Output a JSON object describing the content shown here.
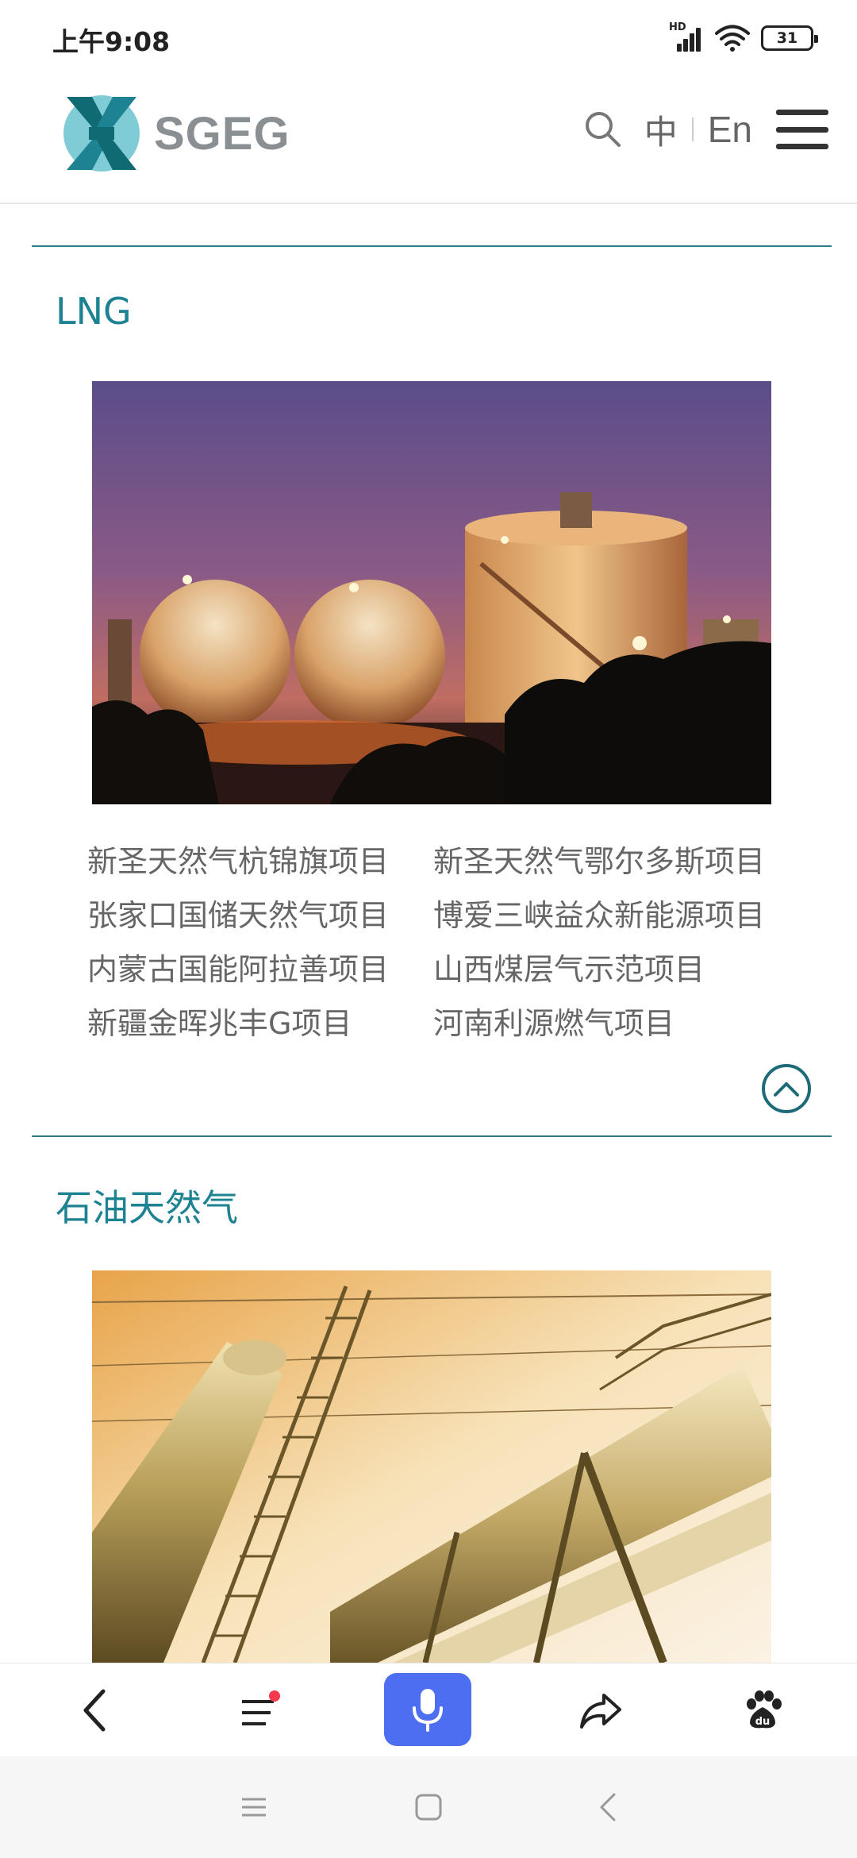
{
  "status_bar": {
    "time": "上午9:08",
    "network_badge": "HD",
    "battery_level": "31"
  },
  "header": {
    "logo_text": "SGEG",
    "lang_cn": "中",
    "lang_en": "En",
    "icons": {
      "search": "search-icon",
      "menu": "hamburger-menu-icon"
    }
  },
  "sections": [
    {
      "title": "LNG",
      "image": "lng-storage-tanks-at-dusk-photo",
      "projects": [
        "新圣天然气杭锦旗项目",
        "新圣天然气鄂尔多斯项目",
        "张家口国储天然气项目",
        "博爱三峡益众新能源项目",
        "内蒙古国能阿拉善项目",
        "山西煤层气示范项目",
        "新疆金晖兆丰G项目",
        "河南利源燃气项目"
      ],
      "collapse_icon": "chevron-up-circle-icon"
    },
    {
      "title": "石油天然气",
      "image": "oil-gas-pipeline-photo"
    }
  ],
  "toolbar": {
    "icons": [
      "back-icon",
      "list-icon",
      "microphone-icon",
      "share-icon",
      "baidu-paw-icon"
    ],
    "accent_color": "#4e6ef2",
    "notification_color": "#f43a4c"
  },
  "system_nav": {
    "icons": [
      "recents-icon",
      "home-icon",
      "back-icon"
    ]
  },
  "colors": {
    "brand_teal": "#1d8291",
    "divider": "#2e7b85",
    "logo_gray": "#8a8f93"
  }
}
